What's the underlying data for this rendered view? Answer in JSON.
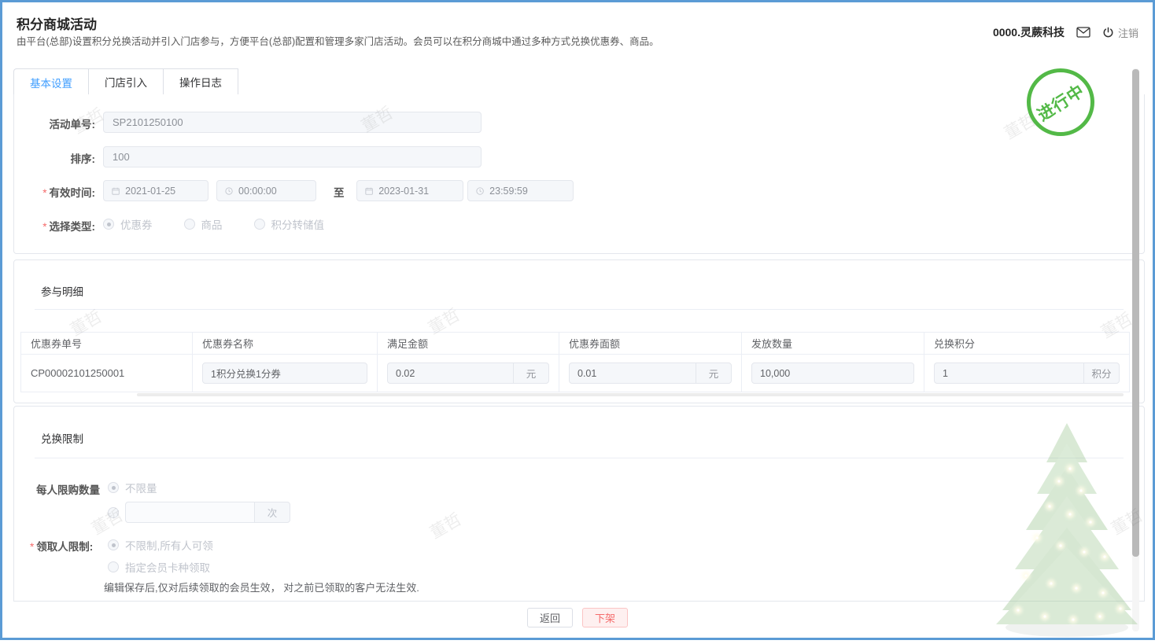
{
  "colors": {
    "accent": "#409eff",
    "status_green": "#45b438",
    "danger": "#f56c6c",
    "frame_blue": "#5b9bd5"
  },
  "header": {
    "title": "积分商城活动",
    "description": "由平台(总部)设置积分兑换活动并引入门店参与，方便平台(总部)配置和管理多家门店活动。会员可以在积分商城中通过多种方式兑换优惠券、商品。",
    "account_name": "0000.灵蕨科技",
    "mail_icon": "envelope-icon",
    "logout_icon": "power-icon",
    "logout_label": "注销"
  },
  "tabs": [
    {
      "label": "基本设置",
      "active": true
    },
    {
      "label": "门店引入",
      "active": false
    },
    {
      "label": "操作日志",
      "active": false
    }
  ],
  "status_stamp": {
    "label": "进行中"
  },
  "form": {
    "activity_no": {
      "label": "活动单号:",
      "value": "SP2101250100"
    },
    "sort": {
      "label": "排序:",
      "value": "100"
    },
    "valid_time": {
      "label": "有效时间:",
      "start_date": "2021-01-25",
      "start_time": "00:00:00",
      "separator": "至",
      "end_date": "2023-01-31",
      "end_time": "23:59:59"
    },
    "type": {
      "label": "选择类型:",
      "options": [
        {
          "label": "优惠券",
          "checked": true
        },
        {
          "label": "商品",
          "checked": false
        },
        {
          "label": "积分转储值",
          "checked": false
        }
      ]
    }
  },
  "participation": {
    "section_title": "参与明细",
    "table": {
      "headers": [
        "优惠券单号",
        "优惠券名称",
        "满足金额",
        "优惠券面额",
        "发放数量",
        "兑换积分"
      ],
      "row": {
        "coupon_no": "CP00002101250001",
        "coupon_name": "1积分兑换1分券",
        "min_amount": "0.02",
        "min_amount_unit": "元",
        "face_value": "0.01",
        "face_value_unit": "元",
        "issue_qty": "10,000",
        "points": "1",
        "points_unit": "积分"
      }
    }
  },
  "restriction": {
    "section_title": "兑换限制",
    "per_person": {
      "label": "每人限购数量",
      "option_unlimited": "不限量",
      "times_value": "",
      "times_unit": "次"
    },
    "receiver": {
      "label": "领取人限制:",
      "option_unlimited": "不限制,所有人可领",
      "option_card": "指定会员卡种领取",
      "note": "编辑保存后,仅对后续领取的会员生效， 对之前已领取的客户无法生效."
    }
  },
  "footer": {
    "back_label": "返回",
    "takedown_label": "下架"
  },
  "watermark": {
    "text": "董哲"
  }
}
